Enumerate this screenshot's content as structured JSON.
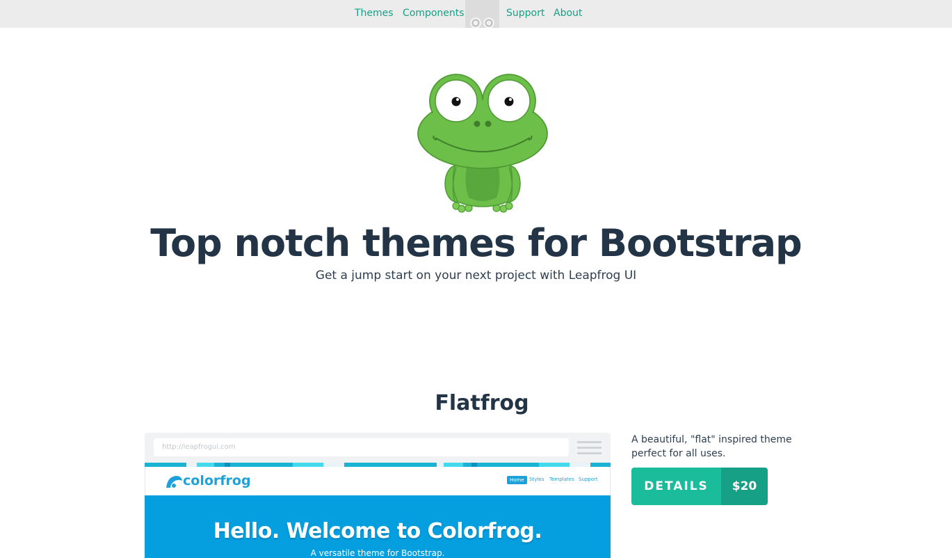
{
  "nav": {
    "themes": "Themes",
    "components": "Components",
    "support": "Support",
    "about": "About",
    "logo_icon": "frog-eyes-icon"
  },
  "hero": {
    "mascot_icon": "frog-mascot",
    "title": "Top notch themes for Bootstrap",
    "subtitle": "Get a jump start on your next project with Leapfrog UI"
  },
  "theme": {
    "name": "Flatfrog",
    "description": "A beautiful, \"flat\" inspired theme perfect for all uses.",
    "details_label": "DETAILS",
    "price": "$20",
    "preview": {
      "url": "http://leapfrogui.com",
      "brand": "colorfrog",
      "nav": [
        "Home",
        "Styles",
        "Templates",
        "Support"
      ],
      "headline": "Hello. Welcome to Colorfrog.",
      "tagline": "A versatile theme for Bootstrap."
    }
  },
  "colors": {
    "accent": "#16a085",
    "accent_light": "#1abc9c",
    "heading": "#233447",
    "frog_green": "#6cc04a",
    "preview_blue": "#059fe0"
  }
}
